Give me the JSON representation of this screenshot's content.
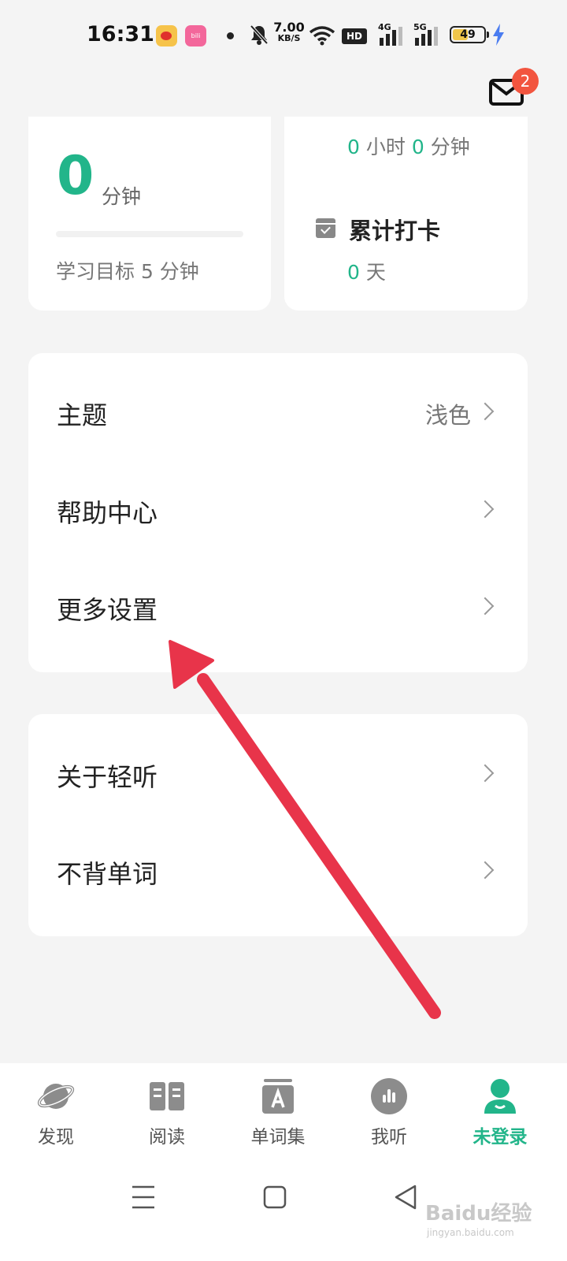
{
  "status_bar": {
    "time": "16:31",
    "net_speed_value": "7.00",
    "net_speed_unit": "KB/S",
    "hd_label": "HD",
    "signal_1_label": "4G",
    "signal_2_label": "5G",
    "battery_level": "49",
    "battery_fraction": 0.49
  },
  "header": {
    "mail_badge_count": "2"
  },
  "stats": {
    "today_minutes": "0",
    "today_unit": "分钟",
    "goal_text": "学习目标 5 分钟",
    "progress": 0,
    "total_hours": "0",
    "hours_unit": "小时",
    "total_minutes": "0",
    "minutes_unit": "分钟",
    "checkin_title": "累计打卡",
    "checkin_days": "0",
    "checkin_unit": "天"
  },
  "settings_menu": {
    "theme_label": "主题",
    "theme_value": "浅色",
    "help_label": "帮助中心",
    "more_label": "更多设置"
  },
  "about_menu": {
    "about_label": "关于轻听",
    "bubei_label": "不背单词"
  },
  "tab_bar": {
    "tabs": [
      {
        "label": "发现",
        "icon": "planet-icon",
        "active": false
      },
      {
        "label": "阅读",
        "icon": "book-icon",
        "active": false
      },
      {
        "label": "单词集",
        "icon": "word-set-icon",
        "active": false
      },
      {
        "label": "我听",
        "icon": "audio-icon",
        "active": false
      },
      {
        "label": "未登录",
        "icon": "user-icon",
        "active": true
      }
    ]
  },
  "watermark": {
    "main": "Baidu经验",
    "sub": "jingyan.baidu.com"
  },
  "colors": {
    "accent": "#22b58a",
    "badge": "#f2553f",
    "annotation_arrow": "#e8344a",
    "background": "#f4f4f4"
  }
}
